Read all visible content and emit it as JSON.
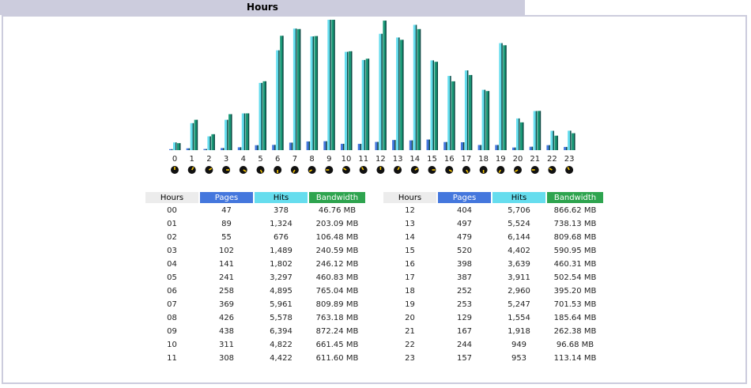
{
  "section": {
    "title": "Hours"
  },
  "table_headers": {
    "hours": "Hours",
    "pages": "Pages",
    "hits": "Hits",
    "bandwidth": "Bandwidth"
  },
  "colors": {
    "pages": "#4477dd",
    "hits": "#66ddee",
    "bandwidth": "#2ea44f",
    "header_bg": "#ccccdd"
  },
  "table_left": [
    {
      "hour": "00",
      "pages": "47",
      "hits": "378",
      "bandwidth": "46.76 MB"
    },
    {
      "hour": "01",
      "pages": "89",
      "hits": "1,324",
      "bandwidth": "203.09 MB"
    },
    {
      "hour": "02",
      "pages": "55",
      "hits": "676",
      "bandwidth": "106.48 MB"
    },
    {
      "hour": "03",
      "pages": "102",
      "hits": "1,489",
      "bandwidth": "240.59 MB"
    },
    {
      "hour": "04",
      "pages": "141",
      "hits": "1,802",
      "bandwidth": "246.12 MB"
    },
    {
      "hour": "05",
      "pages": "241",
      "hits": "3,297",
      "bandwidth": "460.83 MB"
    },
    {
      "hour": "06",
      "pages": "258",
      "hits": "4,895",
      "bandwidth": "765.04 MB"
    },
    {
      "hour": "07",
      "pages": "369",
      "hits": "5,961",
      "bandwidth": "809.89 MB"
    },
    {
      "hour": "08",
      "pages": "426",
      "hits": "5,578",
      "bandwidth": "763.18 MB"
    },
    {
      "hour": "09",
      "pages": "438",
      "hits": "6,394",
      "bandwidth": "872.24 MB"
    },
    {
      "hour": "10",
      "pages": "311",
      "hits": "4,822",
      "bandwidth": "661.45 MB"
    },
    {
      "hour": "11",
      "pages": "308",
      "hits": "4,422",
      "bandwidth": "611.60 MB"
    }
  ],
  "table_right": [
    {
      "hour": "12",
      "pages": "404",
      "hits": "5,706",
      "bandwidth": "866.62 MB"
    },
    {
      "hour": "13",
      "pages": "497",
      "hits": "5,524",
      "bandwidth": "738.13 MB"
    },
    {
      "hour": "14",
      "pages": "479",
      "hits": "6,144",
      "bandwidth": "809.68 MB"
    },
    {
      "hour": "15",
      "pages": "520",
      "hits": "4,402",
      "bandwidth": "590.95 MB"
    },
    {
      "hour": "16",
      "pages": "398",
      "hits": "3,639",
      "bandwidth": "460.31 MB"
    },
    {
      "hour": "17",
      "pages": "387",
      "hits": "3,911",
      "bandwidth": "502.54 MB"
    },
    {
      "hour": "18",
      "pages": "252",
      "hits": "2,960",
      "bandwidth": "395.20 MB"
    },
    {
      "hour": "19",
      "pages": "253",
      "hits": "5,247",
      "bandwidth": "701.53 MB"
    },
    {
      "hour": "20",
      "pages": "129",
      "hits": "1,554",
      "bandwidth": "185.64 MB"
    },
    {
      "hour": "21",
      "pages": "167",
      "hits": "1,918",
      "bandwidth": "262.38 MB"
    },
    {
      "hour": "22",
      "pages": "244",
      "hits": "949",
      "bandwidth": "96.68 MB"
    },
    {
      "hour": "23",
      "pages": "157",
      "hits": "953",
      "bandwidth": "113.14 MB"
    }
  ],
  "chart_data": {
    "type": "bar",
    "categories": [
      "0",
      "1",
      "2",
      "3",
      "4",
      "5",
      "6",
      "7",
      "8",
      "9",
      "10",
      "11",
      "12",
      "13",
      "14",
      "15",
      "16",
      "17",
      "18",
      "19",
      "20",
      "21",
      "22",
      "23"
    ],
    "series": [
      {
        "name": "Pages",
        "color": "#4477dd",
        "values": [
          47,
          89,
          55,
          102,
          141,
          241,
          258,
          369,
          426,
          438,
          311,
          308,
          404,
          497,
          479,
          520,
          398,
          387,
          252,
          253,
          129,
          167,
          244,
          157
        ]
      },
      {
        "name": "Hits",
        "color": "#66ddee",
        "values": [
          378,
          1324,
          676,
          1489,
          1802,
          3297,
          4895,
          5961,
          5578,
          6394,
          4822,
          4422,
          5706,
          5524,
          6144,
          4402,
          3639,
          3911,
          2960,
          5247,
          1554,
          1918,
          949,
          953
        ]
      },
      {
        "name": "Bandwidth",
        "color": "#2ea44f",
        "values": [
          46.76,
          203.09,
          106.48,
          240.59,
          246.12,
          460.83,
          765.04,
          809.89,
          763.18,
          872.24,
          661.45,
          611.6,
          866.62,
          738.13,
          809.68,
          590.95,
          460.31,
          502.54,
          395.2,
          701.53,
          185.64,
          262.38,
          96.68,
          113.14
        ]
      }
    ],
    "hit_scale_max": 6394,
    "bandwidth_scale_max": 872.24,
    "legend": "none",
    "grid": false
  }
}
